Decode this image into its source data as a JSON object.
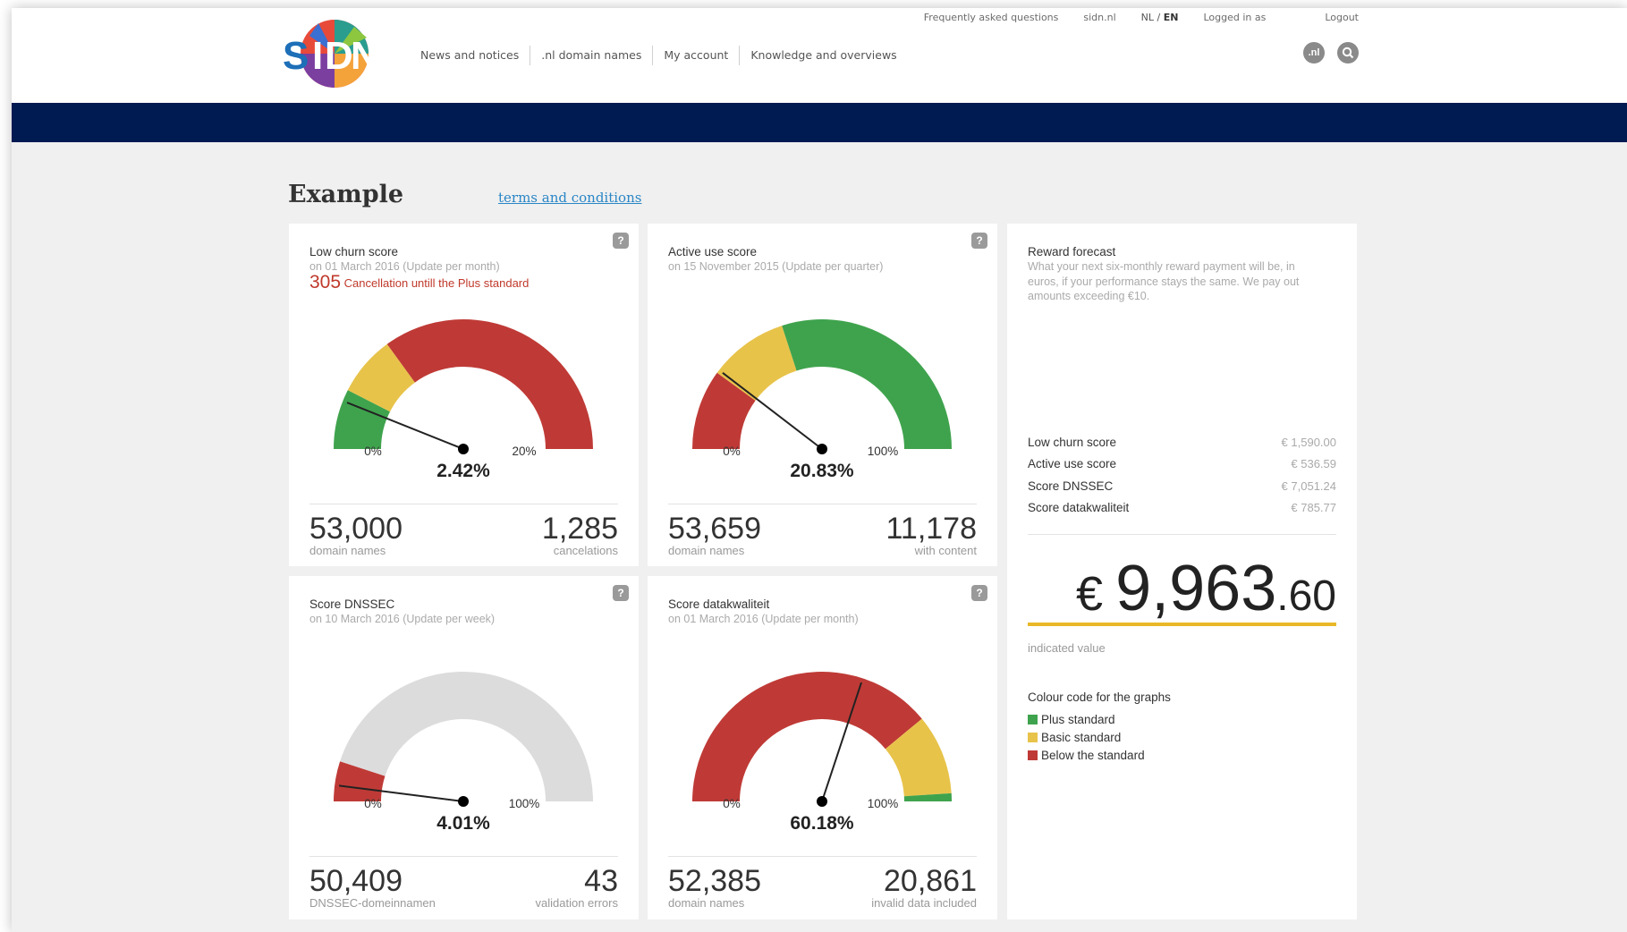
{
  "header": {
    "top_links": [
      "Frequently asked questions",
      "sidn.nl"
    ],
    "lang_nl": "NL",
    "lang_sep": " / ",
    "lang_en": "EN",
    "logged_in": "Logged in as",
    "logout": "Logout",
    "main_nav": [
      "News and notices",
      ".nl domain names",
      "My account",
      "Knowledge and overviews"
    ],
    "nl_icon_label": ".nl",
    "logo_letters": {
      "s": "S",
      "i": "I",
      "d": "D",
      "n": "N"
    }
  },
  "page": {
    "title": "Example",
    "terms_link": "terms and conditions"
  },
  "cards": {
    "low_churn": {
      "title": "Low churn score",
      "subtitle": "on 01 March 2016 (Update per month)",
      "warning_number": "305",
      "warning_text": "Cancellation untill the Plus standard",
      "value_label": "2.42%",
      "value": 2.42,
      "min_label": "0%",
      "max_label": "20%",
      "max": 20,
      "bands": [
        {
          "from": 0,
          "to": 3,
          "color": "#3fa34d"
        },
        {
          "from": 3,
          "to": 6,
          "color": "#e8c34a"
        },
        {
          "from": 6,
          "to": 20,
          "color": "#bf3a36"
        }
      ],
      "left_number": "53,000",
      "left_label": "domain names",
      "right_number": "1,285",
      "right_label": "cancelations"
    },
    "active_use": {
      "title": "Active use score",
      "subtitle": "on 15 November 2015 (Update per quarter)",
      "value_label": "20.83%",
      "value": 20.83,
      "min_label": "0%",
      "max_label": "100%",
      "max": 100,
      "bands": [
        {
          "from": 0,
          "to": 20,
          "color": "#bf3a36"
        },
        {
          "from": 20,
          "to": 40,
          "color": "#e8c34a"
        },
        {
          "from": 40,
          "to": 100,
          "color": "#3fa34d"
        }
      ],
      "left_number": "53,659",
      "left_label": "domain names",
      "right_number": "11,178",
      "right_label": "with content"
    },
    "dnssec": {
      "title": "Score DNSSEC",
      "subtitle": "on 10 March 2016 (Update per week)",
      "value_label": "4.01%",
      "value": 4.01,
      "min_label": "0%",
      "max_label": "100%",
      "max": 100,
      "bands": [
        {
          "from": 0,
          "to": 10,
          "color": "#bf3a36"
        },
        {
          "from": 10,
          "to": 100,
          "color": "#dcdcdc"
        }
      ],
      "left_number": "50,409",
      "left_label": "DNSSEC-domeinnamen",
      "right_number": "43",
      "right_label": "validation errors"
    },
    "data_quality": {
      "title": "Score datakwaliteit",
      "subtitle": "on 01 March 2016 (Update per month)",
      "value_label": "60.18%",
      "value": 60.18,
      "min_label": "0%",
      "max_label": "100%",
      "max": 100,
      "bands": [
        {
          "from": 0,
          "to": 78,
          "color": "#bf3a36"
        },
        {
          "from": 78,
          "to": 98,
          "color": "#e8c34a"
        },
        {
          "from": 98,
          "to": 100,
          "color": "#3fa34d"
        }
      ],
      "left_number": "52,385",
      "left_label": "domain names",
      "right_number": "20,861",
      "right_label": "invalid data included"
    }
  },
  "reward": {
    "title": "Reward forecast",
    "description": "What your next six-monthly reward payment will be, in euros, if your performance stays the same. We pay out amounts exceeding €10.",
    "rows": [
      {
        "label": "Low churn score",
        "value": "€ 1,590.00"
      },
      {
        "label": "Active use score",
        "value": "€ 536.59"
      },
      {
        "label": "Score DNSSEC",
        "value": "€ 7,051.24"
      },
      {
        "label": "Score datakwaliteit",
        "value": "€ 785.77"
      }
    ],
    "currency": "€",
    "total_main": "9,963",
    "total_cents": ".60",
    "indicated": "indicated value",
    "legend_title": "Colour code for the graphs",
    "legend": [
      {
        "label": "Plus standard",
        "color": "#3fa34d"
      },
      {
        "label": "Basic standard",
        "color": "#e8c34a"
      },
      {
        "label": "Below the standard",
        "color": "#bf3a36"
      }
    ]
  }
}
